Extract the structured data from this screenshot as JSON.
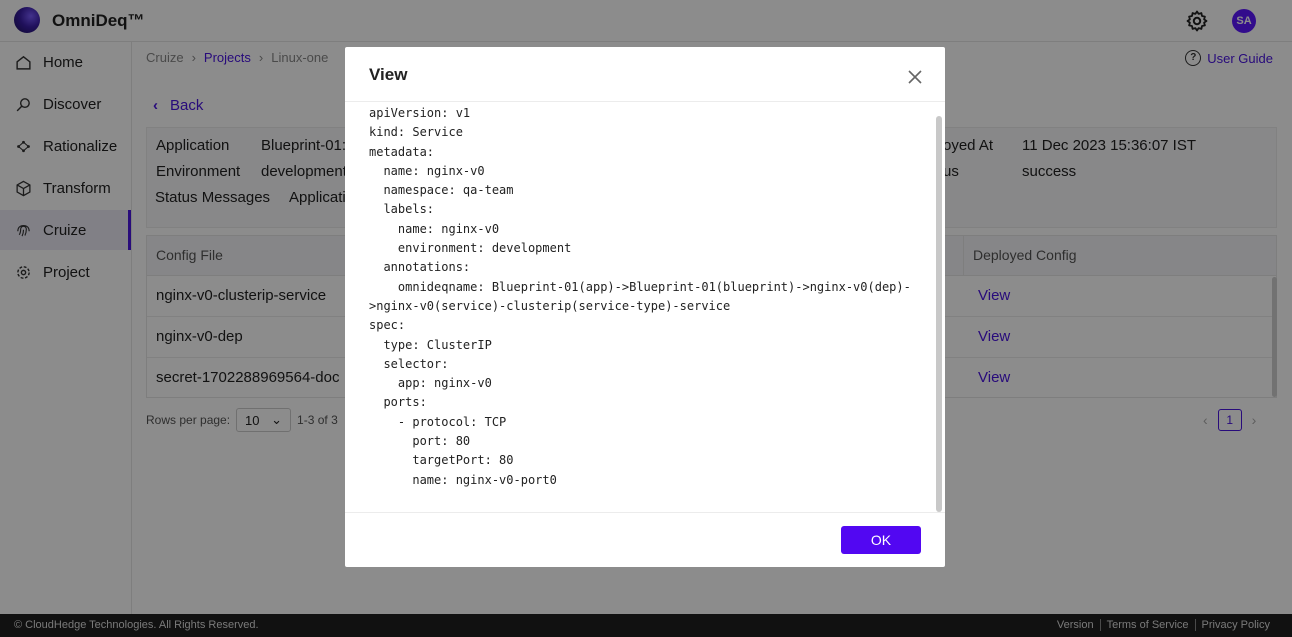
{
  "brand": {
    "name": "OmniDeq™"
  },
  "header": {
    "avatar_initials": "SA",
    "accent": "#5b16ff"
  },
  "sidebar": {
    "items": [
      {
        "label": "Home",
        "icon": "home-icon"
      },
      {
        "label": "Discover",
        "icon": "discover-icon"
      },
      {
        "label": "Rationalize",
        "icon": "rationalize-icon"
      },
      {
        "label": "Transform",
        "icon": "cube-icon"
      },
      {
        "label": "Cruize",
        "icon": "fingerprint-icon",
        "active": true
      },
      {
        "label": "Project",
        "icon": "gear-icon"
      }
    ]
  },
  "breadcrumb": [
    "Cruize",
    "Projects",
    "Linux-one"
  ],
  "user_guide": "User Guide",
  "back_label": "Back",
  "info": {
    "application_label": "Application",
    "application_value": "Blueprint-01:",
    "environment_label": "Environment",
    "environment_value": "development",
    "status_messages_label": "Status Messages",
    "status_messages_value": "Applicati",
    "deployed_at_label": "oyed At",
    "deployed_at_value": "11 Dec 2023 15:36:07 IST",
    "status_label": "us",
    "status_value": "success"
  },
  "table": {
    "headers": {
      "config_file": "Config File",
      "deployed_config": "Deployed Config"
    },
    "rows": [
      {
        "config_file": "nginx-v0-clusterip-service",
        "action": "View"
      },
      {
        "config_file": "nginx-v0-dep",
        "action": "View"
      },
      {
        "config_file": "secret-1702288969564-doc",
        "action": "View"
      }
    ]
  },
  "pagination": {
    "rows_per_page_label": "Rows per page:",
    "rows_per_page_value": "10",
    "range": "1-3 of 3",
    "current_page": "1"
  },
  "footer": {
    "copyright": "© CloudHedge Technologies. All Rights Reserved.",
    "links": [
      "Version",
      "Terms of Service",
      "Privacy Policy"
    ]
  },
  "modal": {
    "title": "View",
    "ok_label": "OK",
    "content": "apiVersion: v1\nkind: Service\nmetadata:\n  name: nginx-v0\n  namespace: qa-team\n  labels:\n    name: nginx-v0\n    environment: development\n  annotations:\n    omnideqname: Blueprint-01(app)->Blueprint-01(blueprint)->nginx-v0(dep)->nginx-v0(service)-clusterip(service-type)-service\nspec:\n  type: ClusterIP\n  selector:\n    app: nginx-v0\n  ports:\n    - protocol: TCP\n      port: 80\n      targetPort: 80\n      name: nginx-v0-port0"
  }
}
